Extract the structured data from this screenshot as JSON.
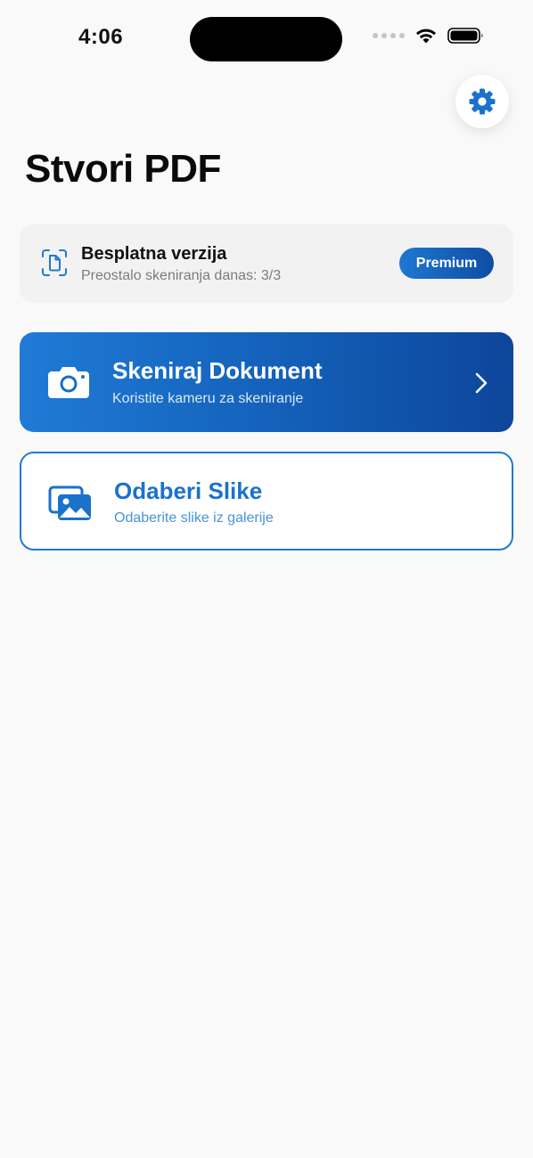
{
  "status_bar": {
    "time": "4:06"
  },
  "header": {
    "title": "Stvori PDF",
    "settings_icon": "gear-icon"
  },
  "plan": {
    "title": "Besplatna verzija",
    "subtitle": "Preostalo skeniranja danas: 3/3",
    "premium_label": "Premium",
    "icon": "document-scan-icon"
  },
  "actions": {
    "scan": {
      "title": "Skeniraj Dokument",
      "subtitle": "Koristite kameru za skeniranje",
      "icon": "camera-icon"
    },
    "gallery": {
      "title": "Odaberi Slike",
      "subtitle": "Odaberite slike iz galerije",
      "icon": "photos-icon"
    }
  },
  "colors": {
    "accent": "#1a72cb",
    "accent_dark": "#0d469b",
    "background": "#f9f9f9"
  }
}
